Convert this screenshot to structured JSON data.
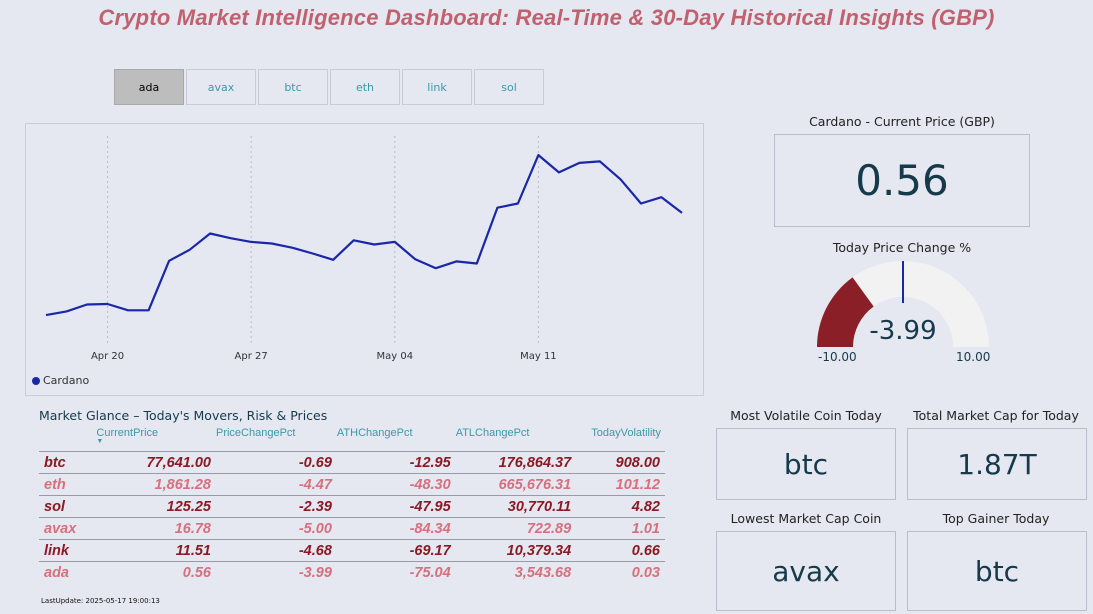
{
  "title": "Crypto Market Intelligence Dashboard: Real-Time & 30-Day Historical Insights (GBP)",
  "tabs": [
    {
      "label": "ada",
      "active": true
    },
    {
      "label": "avax",
      "active": false
    },
    {
      "label": "btc",
      "active": false
    },
    {
      "label": "eth",
      "active": false
    },
    {
      "label": "link",
      "active": false
    },
    {
      "label": "sol",
      "active": false
    }
  ],
  "chart_data": {
    "type": "line",
    "series": [
      {
        "name": "Cardano",
        "color": "#1a27a6",
        "x": [
          "2025-04-17",
          "2025-04-18",
          "2025-04-19",
          "2025-04-20",
          "2025-04-21",
          "2025-04-22",
          "2025-04-23",
          "2025-04-24",
          "2025-04-25",
          "2025-04-26",
          "2025-04-27",
          "2025-04-28",
          "2025-04-29",
          "2025-04-30",
          "2025-05-01",
          "2025-05-02",
          "2025-05-03",
          "2025-05-04",
          "2025-05-05",
          "2025-05-06",
          "2025-05-07",
          "2025-05-08",
          "2025-05-09",
          "2025-05-10",
          "2025-05-11",
          "2025-05-12",
          "2025-05-13",
          "2025-05-14",
          "2025-05-15",
          "2025-05-16",
          "2025-05-17",
          "2025-05-18"
        ],
        "values": [
          0.496,
          0.503,
          0.516,
          0.517,
          0.505,
          0.505,
          0.599,
          0.62,
          0.651,
          0.642,
          0.635,
          0.632,
          0.624,
          0.613,
          0.601,
          0.638,
          0.63,
          0.635,
          0.602,
          0.585,
          0.598,
          0.594,
          0.7,
          0.708,
          0.8,
          0.767,
          0.785,
          0.788,
          0.754,
          0.708,
          0.72,
          0.69
        ]
      }
    ],
    "x_ticks": [
      "Apr 20",
      "Apr 27",
      "May 04",
      "May 11"
    ],
    "ylim": [
      0.46,
      0.84
    ],
    "grid": "vertical-dotted",
    "legend": "bottom-left",
    "legend_label": "Cardano"
  },
  "price_card": {
    "label": "Cardano - Current Price (GBP)",
    "value": "0.56"
  },
  "gauge": {
    "label": "Today Price Change %",
    "value": -3.99,
    "value_text": "-3.99",
    "min": -10,
    "max": 10,
    "min_text": "-10.00",
    "max_text": "10.00",
    "target": 0,
    "fill_color": "#8b1f27",
    "track_color": "#f2f2f2",
    "target_color": "#1a27a6"
  },
  "cards": {
    "most_volatile": {
      "label": "Most Volatile Coin Today",
      "value": "btc"
    },
    "total_market_cap": {
      "label": "Total Market Cap for Today",
      "value": "1.87T"
    },
    "lowest_market_cap": {
      "label": "Lowest Market Cap Coin",
      "value": "avax"
    },
    "top_gainer": {
      "label": "Top Gainer Today",
      "value": "btc"
    }
  },
  "table": {
    "title": "Market Glance – Today's Movers, Risk & Prices",
    "columns": [
      "",
      "CurrentPrice",
      "PriceChangePct",
      "ATHChangePct",
      "ATLChangePct",
      "TodayVolatility"
    ],
    "rows": [
      [
        "btc",
        "77,641.00",
        "-0.69",
        "-12.95",
        "176,864.37",
        "908.00"
      ],
      [
        "eth",
        "1,861.28",
        "-4.47",
        "-48.30",
        "665,676.31",
        "101.12"
      ],
      [
        "sol",
        "125.25",
        "-2.39",
        "-47.95",
        "30,770.11",
        "4.82"
      ],
      [
        "avax",
        "16.78",
        "-5.00",
        "-84.34",
        "722.89",
        "1.01"
      ],
      [
        "link",
        "11.51",
        "-4.68",
        "-69.17",
        "10,379.34",
        "0.66"
      ],
      [
        "ada",
        "0.56",
        "-3.99",
        "-75.04",
        "3,543.68",
        "0.03"
      ]
    ]
  },
  "last_update": "LastUpdate: 2025-05-17 19:00:13"
}
